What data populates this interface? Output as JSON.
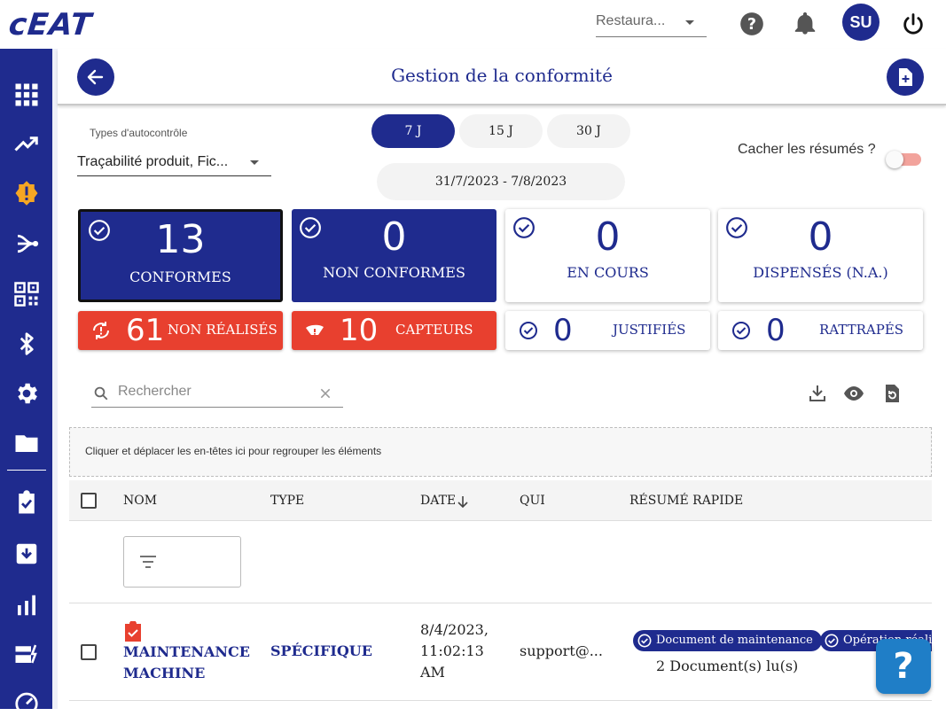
{
  "app": {
    "logo": "cEAT",
    "restaurant_select": "Restaura...",
    "avatar_initials": "SU"
  },
  "header": {
    "title": "Gestion de la conformité"
  },
  "filters": {
    "types_label": "Types d'autocontrôle",
    "types_value": "Traçabilité produit, Fic...",
    "periods": [
      "7 J",
      "15 J",
      "30 J"
    ],
    "active_period": "7 J",
    "date_range": "31/7/2023 - 7/8/2023",
    "hide_summaries_label": "Cacher les résumés ?"
  },
  "cards": [
    {
      "count": "13",
      "label": "CONFORMES",
      "style": "blue-selected"
    },
    {
      "count": "0",
      "label": "NON CONFORMES",
      "style": "blue"
    },
    {
      "count": "0",
      "label": "EN COURS",
      "style": "white"
    },
    {
      "count": "0",
      "label": "DISPENSÉS (N.A.)",
      "style": "white"
    }
  ],
  "stats": [
    {
      "count": "61",
      "label": "NON RÉALISÉS",
      "style": "red",
      "icon": "sync-problem-icon"
    },
    {
      "count": "10",
      "label": "CAPTEURS",
      "style": "red",
      "icon": "sensor-icon"
    },
    {
      "count": "0",
      "label": "JUSTIFIÉS",
      "style": "white",
      "icon": "check-circle-icon"
    },
    {
      "count": "0",
      "label": "RATTRAPÉS",
      "style": "white",
      "icon": "check-circle-icon"
    }
  ],
  "search": {
    "placeholder": "Rechercher"
  },
  "grid": {
    "group_hint": "Cliquer et déplacer les en-têtes ici pour regrouper les éléments",
    "columns": [
      "NOM",
      "TYPE",
      "DATE",
      "QUI",
      "RÉSUMÉ RAPIDE"
    ],
    "rows": [
      {
        "name": "MAINTENANCE MACHINE",
        "type": "SPÉCIFIQUE",
        "date": "8/4/2023, 11:02:13 AM",
        "who": "support@...",
        "chips": [
          "Document de maintenance",
          "Opération réalis"
        ],
        "summary": "2 Document(s) lu(s)"
      }
    ]
  },
  "help_fab": "?",
  "colors": {
    "primary": "#1f2b8e",
    "alert": "#e8402f",
    "help": "#1f7ec7"
  }
}
